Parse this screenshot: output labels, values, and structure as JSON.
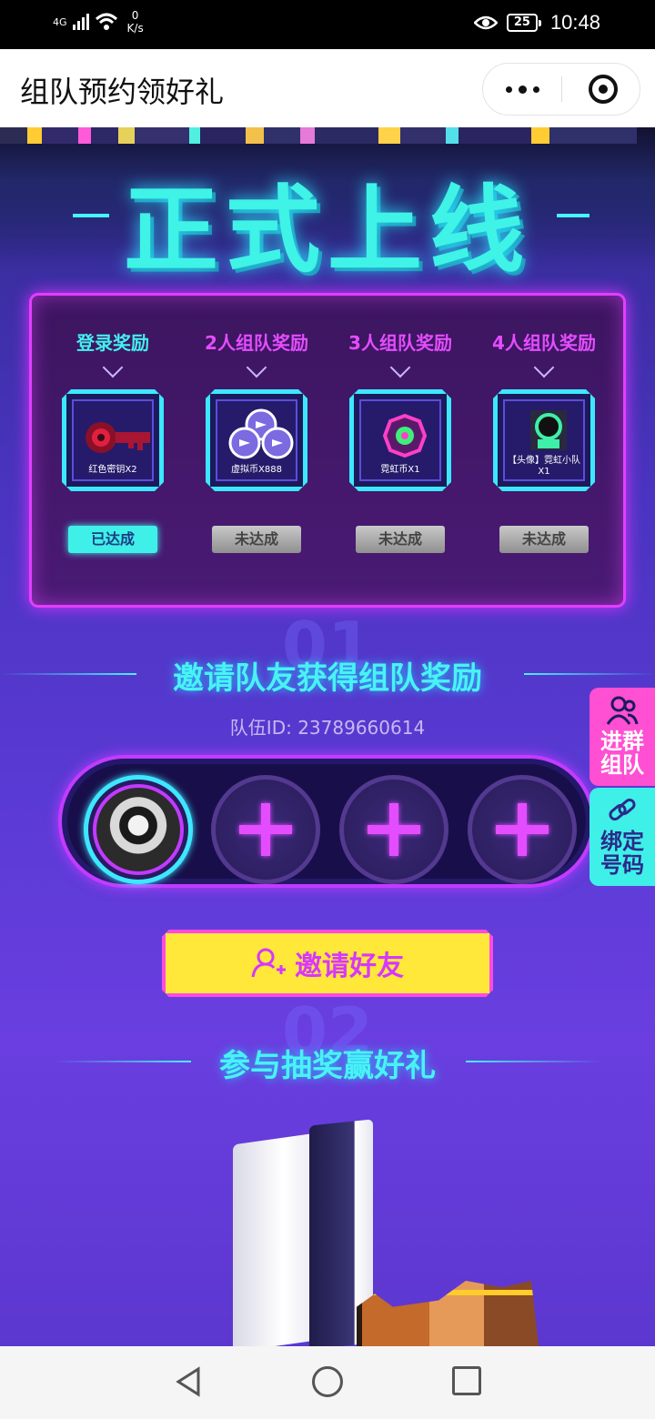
{
  "status_bar": {
    "network": "4G",
    "speed_value": "0",
    "speed_unit": "K/s",
    "battery": "25",
    "time": "10:48"
  },
  "title_bar": {
    "title": "组队预约领好礼",
    "more_icon": "more-dots-icon",
    "close_icon": "target-icon"
  },
  "banner": {
    "headline": "正式上线"
  },
  "rewards": [
    {
      "title": "登录奖励",
      "item": "红色密钥X2",
      "status": "已达成",
      "achieved": true,
      "title_color": "#43f0ef"
    },
    {
      "title": "2人组队奖励",
      "item": "虚拟币X888",
      "status": "未达成",
      "achieved": false,
      "title_color": "#e44dff"
    },
    {
      "title": "3人组队奖励",
      "item": "霓虹币X1",
      "status": "未达成",
      "achieved": false,
      "title_color": "#e44dff"
    },
    {
      "title": "4人组队奖励",
      "item": "【头像】霓虹小队X1",
      "status": "未达成",
      "achieved": false,
      "title_color": "#e44dff"
    }
  ],
  "section1": {
    "number": "01",
    "title": "邀请队友获得组队奖励",
    "team_id_label": "队伍ID:",
    "team_id": "23789660614"
  },
  "team_slots": [
    {
      "state": "member",
      "icon": "avatar"
    },
    {
      "state": "empty",
      "icon": "plus-icon"
    },
    {
      "state": "empty",
      "icon": "plus-icon"
    },
    {
      "state": "empty",
      "icon": "plus-icon"
    }
  ],
  "side_tabs": {
    "join_group_line1": "进群",
    "join_group_line2": "组队",
    "bind_number_line1": "绑定",
    "bind_number_line2": "号码"
  },
  "invite_button": {
    "label": "邀请好友",
    "icon": "add-user-icon"
  },
  "section2": {
    "number": "02",
    "title": "参与抽奖赢好礼"
  },
  "colors": {
    "accent_cyan": "#3ff0e8",
    "accent_magenta": "#e43dff",
    "button_yellow": "#ffe83a"
  }
}
